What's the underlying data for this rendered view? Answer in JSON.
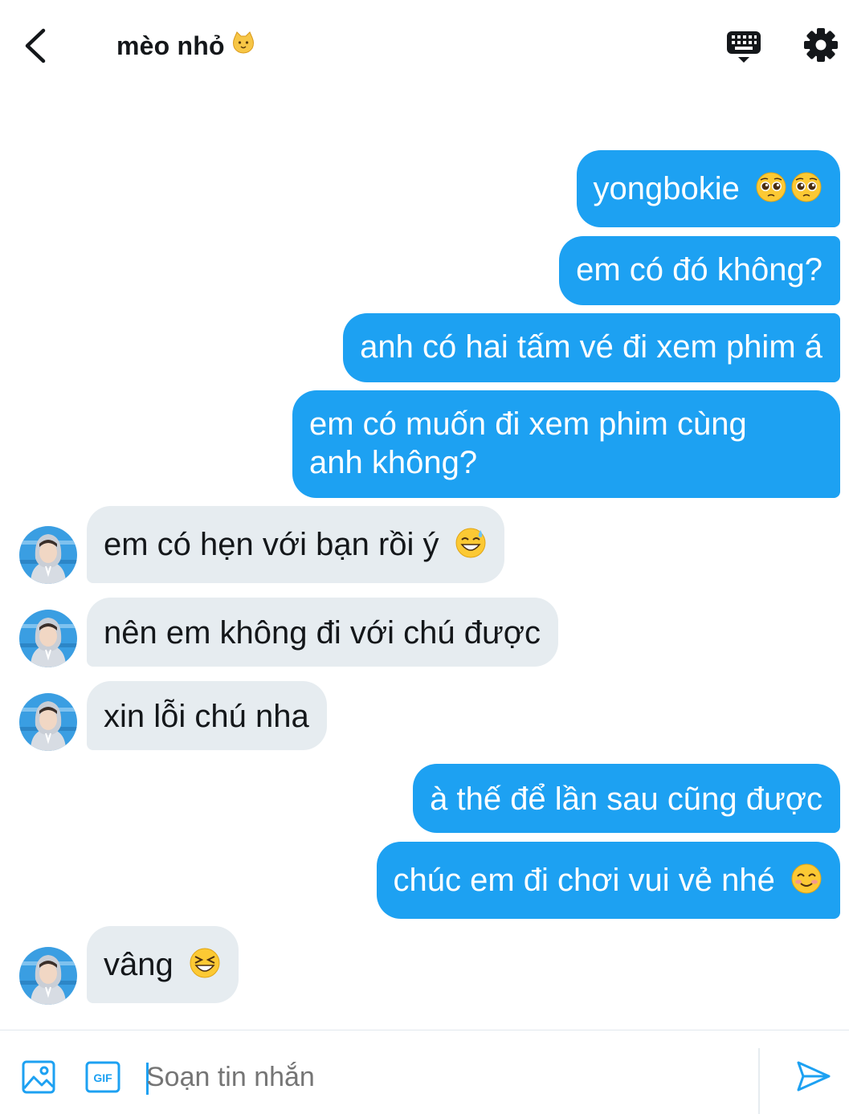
{
  "header": {
    "title": "mèo nhỏ",
    "title_emoji": "cat-face-emoji",
    "back_icon": "chevron-left-icon",
    "keyboard_icon": "keyboard-icon",
    "settings_icon": "gear-icon"
  },
  "messages": [
    {
      "side": "out",
      "text": "yongbokie",
      "emoji": "pleading-face-emoji pleading-face-emoji"
    },
    {
      "side": "out",
      "text": "em có đó không?"
    },
    {
      "side": "out",
      "text": "anh có hai tấm vé đi xem phim á"
    },
    {
      "side": "out",
      "text_line1": "em có muốn đi xem phim cùng",
      "text_line2": "anh không?"
    },
    {
      "side": "in",
      "text": "em có hẹn với bạn rồi ý",
      "emoji": "grinning-sweat-emoji"
    },
    {
      "side": "in",
      "text": "nên em không đi với chú được"
    },
    {
      "side": "in",
      "text": "xin lỗi chú nha"
    },
    {
      "side": "out",
      "text": "à thế để lần sau cũng được"
    },
    {
      "side": "out",
      "text": "chúc em đi chơi vui vẻ nhé",
      "emoji": "smiling-face-emoji"
    },
    {
      "side": "in",
      "text": "vâng",
      "emoji": "squinting-laughing-emoji"
    }
  ],
  "composer": {
    "placeholder": "Soạn tin nhắn",
    "gif_label": "GIF",
    "media_icon": "image-icon",
    "send_icon": "send-icon"
  },
  "colors": {
    "accent": "#1da1f2",
    "incoming_bubble": "#e6ecf0",
    "text": "#14171a",
    "placeholder": "#657786"
  }
}
